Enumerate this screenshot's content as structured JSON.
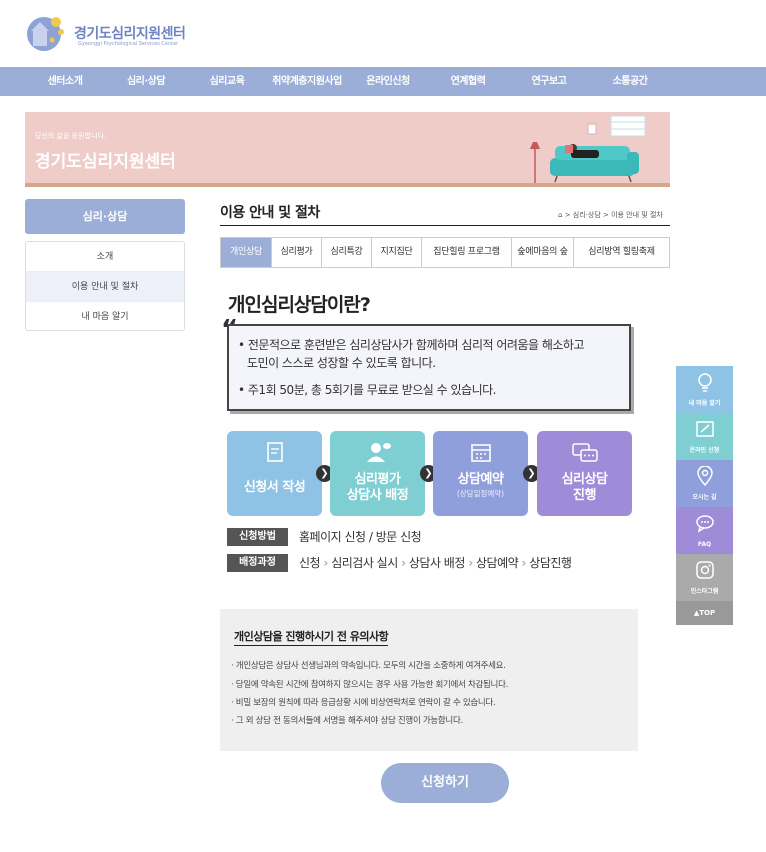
{
  "header": {
    "logo_title": "경기도심리지원센터",
    "logo_subtitle": "Gyeonggi Psychological Services Center"
  },
  "nav": {
    "items": [
      "센터소개",
      "심리·상담",
      "심리교육",
      "취약계층지원사업",
      "온라인신청",
      "연계협력",
      "연구보고",
      "소통공간"
    ]
  },
  "banner": {
    "small": "당신의 삶을 응원합니다.",
    "title": "경기도심리지원센터"
  },
  "sidebar": {
    "heading": "심리·상담",
    "items": [
      {
        "label": "소개"
      },
      {
        "label": "이용 안내 및 절차"
      },
      {
        "label": "내 마음 알기"
      }
    ]
  },
  "main": {
    "page_title": "이용 안내 및 절차",
    "breadcrumb": "> 심리·상담 > 이용 안내 및 절차",
    "tabs": [
      "개인상담",
      "심리평가",
      "심리특강",
      "지지집단",
      "집단힐링 프로그램",
      "숲에마음의 숲",
      "심리방역 힐링축제"
    ],
    "section_title": "개인심리상담이란?",
    "quote_mark": "“",
    "info": {
      "line1": "• 전문적으로 훈련받은 심리상담사가 함께하며 심리적 어려움을 해소하고",
      "line2": "도민이 스스로 성장할 수 있도록 합니다.",
      "line3": "• 주1회 50분, 총 5회기를 무료로 받으실 수 있습니다."
    },
    "steps": [
      {
        "line1": "신청서 작성",
        "line2": "",
        "sub": "",
        "color": "#8fc3e6"
      },
      {
        "line1": "심리평가",
        "line2": "상담사 배정",
        "sub": "",
        "color": "#7fcfd2"
      },
      {
        "line1": "상담예약",
        "line2": "",
        "sub": "(상담일정예약)",
        "color": "#8f9fdc"
      },
      {
        "line1": "심리상담",
        "line2": "진행",
        "sub": "",
        "color": "#a08bd8"
      }
    ],
    "method": {
      "tag": "신청방법",
      "text": "홈페이지 신청 / 방문 신청"
    },
    "process": {
      "tag": "배정과정",
      "items": [
        "신청",
        "심리검사 실시",
        "상담사 배정",
        "상담예약",
        "상담진행"
      ]
    },
    "notice": {
      "title": "개인상담을 진행하시기 전 유의사항",
      "lines": [
        "· 개인상담은 상담사 선생님과의 약속입니다. 모두의 시간을 소중하게 여겨주세요.",
        "· 당일에 약속된 시간에 참여하지 않으시는 경우 사용 가능한 회기에서 차감됩니다.",
        "· 비밀 보장의 원칙에 따라 응급상황 시에 비상연락처로 연락이 갈 수 있습니다.",
        "· 그 외 상담 전 동의서들에 서명을 해주셔야 상담 진행이 가능합니다."
      ]
    },
    "apply_label": "신청하기"
  },
  "quick_menu": {
    "items": [
      {
        "label": "내 마음 알기",
        "color": "#8fc3e6",
        "icon": "lightbulb-icon"
      },
      {
        "label": "온라인 신청",
        "color": "#7fcfd2",
        "icon": "edit-icon"
      },
      {
        "label": "오시는 길",
        "color": "#8f9fdc",
        "icon": "location-icon"
      },
      {
        "label": "FAQ",
        "color": "#a08bd8",
        "icon": "chat-icon"
      },
      {
        "label": "인스타그램",
        "color": "#aaaaaa",
        "icon": "instagram-icon"
      }
    ],
    "top_label": "▲TOP"
  },
  "colors": {
    "accent": "#9aaed7",
    "banner_bg": "#efccc8",
    "notice_bg": "#efefef"
  }
}
